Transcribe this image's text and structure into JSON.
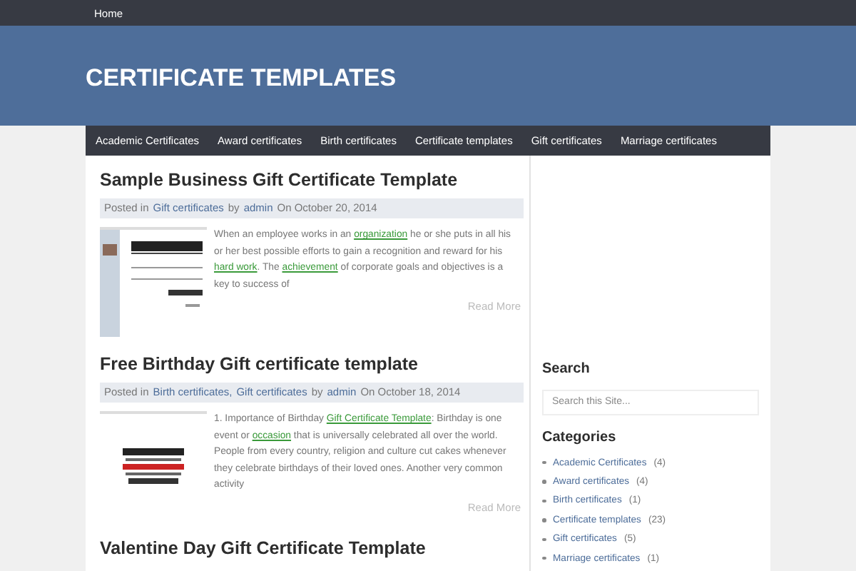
{
  "top_nav": [
    "Home"
  ],
  "site_title": "CERTIFICATE TEMPLATES",
  "nav": [
    "Academic Certificates",
    "Award certificates",
    "Birth certificates",
    "Certificate templates",
    "Gift certificates",
    "Marriage certificates"
  ],
  "posts": [
    {
      "title": "Sample Business Gift Certificate Template",
      "posted_in": "Posted in",
      "categories": [
        "Gift certificates"
      ],
      "by": "by",
      "author": "admin",
      "on": "On October 20, 2014",
      "body": [
        {
          "text": "When an employee works in an ",
          "link": false
        },
        {
          "text": "organization",
          "link": true
        },
        {
          "text": " he or she puts in all his or her best possible efforts to gain a recognition and reward for his ",
          "link": false
        },
        {
          "text": "hard work",
          "link": true
        },
        {
          "text": ". The ",
          "link": false
        },
        {
          "text": "achievement",
          "link": true
        },
        {
          "text": " of corporate goals and objectives is a key to success of",
          "link": false
        }
      ],
      "read_more": "Read More"
    },
    {
      "title": "Free Birthday Gift certificate template",
      "posted_in": "Posted in",
      "categories": [
        "Birth certificates,",
        "Gift certificates"
      ],
      "by": "by",
      "author": "admin",
      "on": "On October 18, 2014",
      "body": [
        {
          "text": "1. Importance of Birthday ",
          "link": false
        },
        {
          "text": "Gift Certificate Template",
          "link": true
        },
        {
          "text": ": Birthday is one event or ",
          "link": false
        },
        {
          "text": "occasion",
          "link": true
        },
        {
          "text": " that is universally celebrated all over the world. People from every country, religion and culture cut cakes whenever they celebrate birthdays of their loved ones. Another very common activity",
          "link": false
        }
      ],
      "read_more": "Read More"
    },
    {
      "title": "Valentine Day Gift Certificate Template"
    }
  ],
  "sidebar": {
    "search_title": "Search",
    "search": {
      "placeholder": "Search this Site..."
    },
    "categories_title": "Categories",
    "categories": [
      {
        "name": "Academic Certificates",
        "count": "(4)"
      },
      {
        "name": "Award certificates",
        "count": "(4)"
      },
      {
        "name": "Birth certificates",
        "count": "(1)"
      },
      {
        "name": "Certificate templates",
        "count": "(23)"
      },
      {
        "name": "Gift certificates",
        "count": "(5)"
      },
      {
        "name": "Marriage certificates",
        "count": "(1)"
      }
    ]
  }
}
